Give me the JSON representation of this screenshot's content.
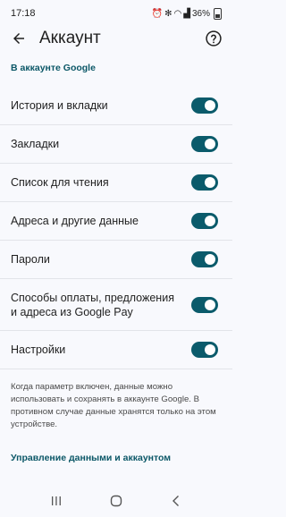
{
  "status_bar": {
    "time": "17:18",
    "battery": "36%",
    "icons": [
      "alarm-icon",
      "bluetooth-icon",
      "wifi-icon",
      "signal-icon",
      "battery-icon"
    ]
  },
  "app_bar": {
    "title": "Аккаунт",
    "back_icon": "arrow-back-icon",
    "help_icon": "help-icon"
  },
  "section": {
    "header": "В аккаунте Google",
    "items": [
      {
        "label": "История и вкладки",
        "enabled": true
      },
      {
        "label": "Закладки",
        "enabled": true
      },
      {
        "label": "Список для чтения",
        "enabled": true
      },
      {
        "label": "Адреса и другие данные",
        "enabled": true
      },
      {
        "label": "Пароли",
        "enabled": true
      },
      {
        "label": "Способы оплаты, предложения и адреса из Google Pay",
        "enabled": true
      },
      {
        "label": "Настройки",
        "enabled": true
      }
    ]
  },
  "note": "Когда параметр включен, данные можно использовать и сохранять в аккаунте Google. В противном случае данные хранятся только на этом устройстве.",
  "manage_link": "Управление данными и аккаунтом",
  "colors": {
    "accent": "#0b5767",
    "toggle_on": "#0b5b6b",
    "background": "#f8f9fd"
  },
  "nav_bar": {
    "icons": [
      "recents-icon",
      "home-icon",
      "back-icon"
    ]
  }
}
